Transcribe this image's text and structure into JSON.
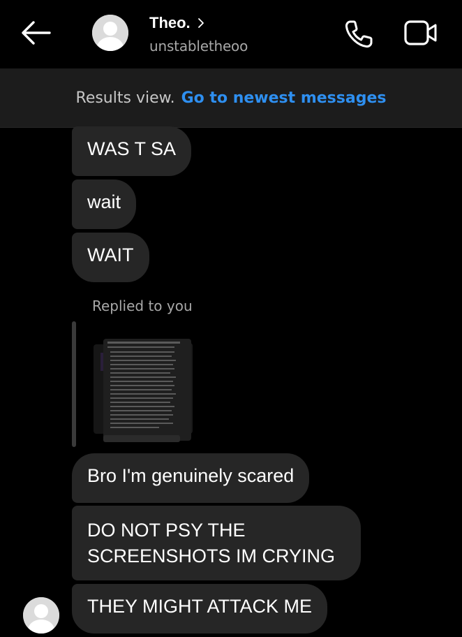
{
  "header": {
    "back_icon": "arrow-left-icon",
    "contact_name": "Theo.",
    "username": "unstabletheoo",
    "call_icon": "phone-icon",
    "video_icon": "video-camera-icon"
  },
  "banner": {
    "results_text": "Results view.",
    "newest_link": "Go to newest messages"
  },
  "messages": [
    {
      "text": "WAS T SA"
    },
    {
      "text": "wait"
    },
    {
      "text": "WAIT"
    },
    {
      "text": "Bro I'm genuinely scared"
    },
    {
      "text": "DO NOT PSY THE SCREENSHOTS IM CRYING"
    },
    {
      "text": "THEY MIGHT ATTACK ME"
    }
  ],
  "reply": {
    "label": "Replied to you",
    "thumbnail": "screenshot-image"
  },
  "colors": {
    "background": "#000000",
    "bubble": "#262626",
    "banner": "#1c1c1c",
    "link": "#2e8ff0",
    "muted_text": "#a8a8a8"
  }
}
